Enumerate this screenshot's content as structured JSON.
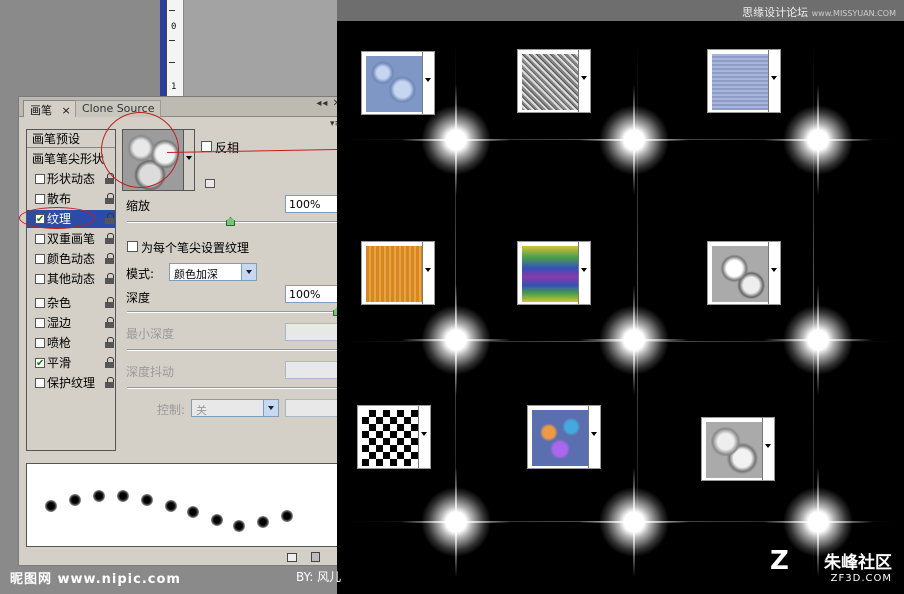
{
  "panel": {
    "tabs": [
      {
        "label": "画笔",
        "active": true
      },
      {
        "label": "Clone Source",
        "active": false
      }
    ],
    "tab_close": "×",
    "window_controls": "◂◂ ✕",
    "menu_glyph": "▾≡"
  },
  "brush_list": {
    "header": "画笔预设",
    "items": [
      {
        "label": "画笔笔尖形状",
        "checkbox": false,
        "checked": false,
        "lock": false
      },
      {
        "label": "形状动态",
        "checkbox": true,
        "checked": false,
        "lock": true
      },
      {
        "label": "散布",
        "checkbox": true,
        "checked": false,
        "lock": true
      },
      {
        "label": "纹理",
        "checkbox": true,
        "checked": true,
        "lock": true,
        "selected": true
      },
      {
        "label": "双重画笔",
        "checkbox": true,
        "checked": false,
        "lock": true
      },
      {
        "label": "颜色动态",
        "checkbox": true,
        "checked": false,
        "lock": true
      },
      {
        "label": "其他动态",
        "checkbox": true,
        "checked": false,
        "lock": true
      },
      {
        "label": "杂色",
        "checkbox": true,
        "checked": false,
        "lock": true
      },
      {
        "label": "湿边",
        "checkbox": true,
        "checked": false,
        "lock": true
      },
      {
        "label": "喷枪",
        "checkbox": true,
        "checked": false,
        "lock": true
      },
      {
        "label": "平滑",
        "checkbox": true,
        "checked": true,
        "lock": true
      },
      {
        "label": "保护纹理",
        "checkbox": true,
        "checked": false,
        "lock": true
      }
    ]
  },
  "texture": {
    "invert_label": "反相",
    "scale_label": "缩放",
    "scale_value": "100%",
    "scale_level": 0.5,
    "per_tip_label": "为每个笔尖设置纹理",
    "mode_label": "模式:",
    "mode_value": "颜色加深",
    "depth_label": "深度",
    "depth_value": "100%",
    "depth_level": 1.0,
    "min_depth_label": "最小深度",
    "min_depth_value": "",
    "depth_jitter_label": "深度抖动",
    "depth_jitter_value": "",
    "control_label": "控制:",
    "control_value": "关",
    "control_field": ""
  },
  "watermarks": {
    "top_right": "思缘设计论坛",
    "top_right_url": "www.MISSYUAN.COM",
    "bottom_left": "昵图网  www.nipic.com",
    "author": "BY: 风儿",
    "logo_main": "朱峰社区",
    "logo_sub": "ZF3D.COM"
  },
  "texture_swatches": [
    {
      "name": "blue-bubbles",
      "color": "#7f97c4"
    },
    {
      "name": "gray-noise",
      "color": "#b7b7b7"
    },
    {
      "name": "blue-fabric",
      "color": "#8d9cc7"
    },
    {
      "name": "wood",
      "color": "#e0952e"
    },
    {
      "name": "rainbow",
      "color": "#6b6fc0"
    },
    {
      "name": "crumpled-metal",
      "color": "#c8c8c8"
    },
    {
      "name": "checkerboard",
      "color": "#000000"
    },
    {
      "name": "colorful-marble",
      "color": "#7a6ab4"
    },
    {
      "name": "clouds",
      "color": "#bcbcbc"
    }
  ]
}
